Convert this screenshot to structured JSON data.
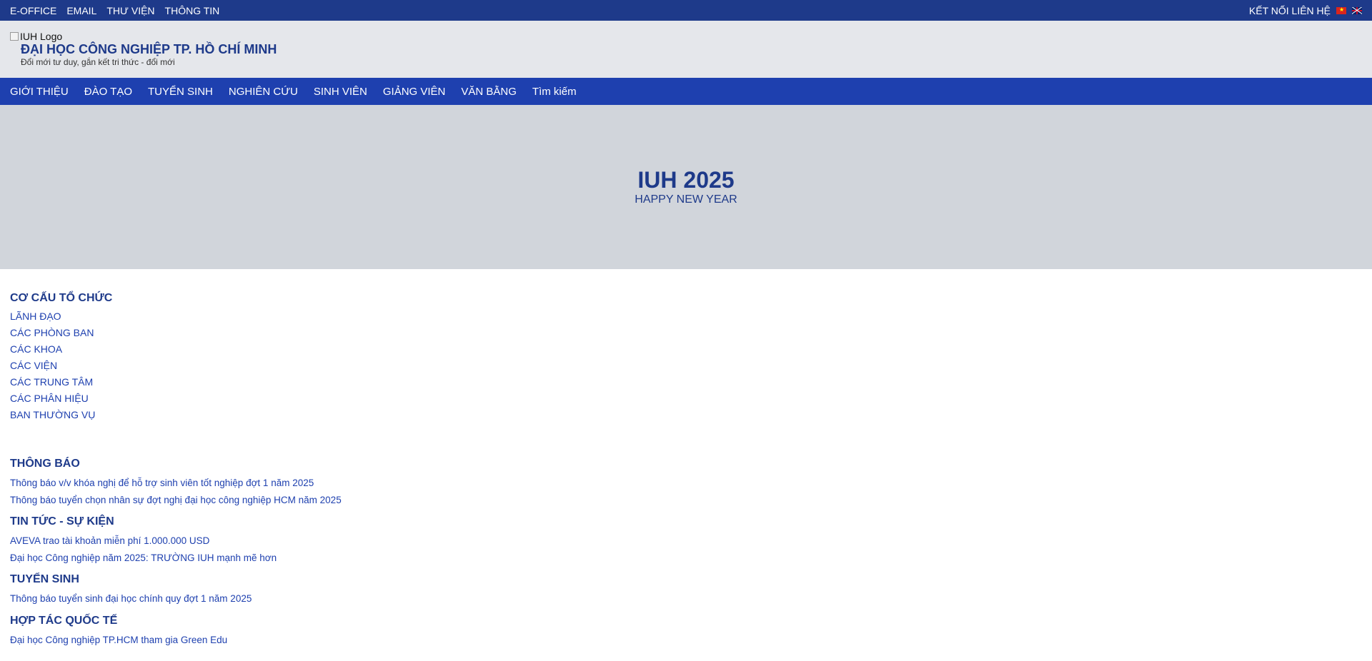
{
  "topbar": {
    "links": [
      "E-OFFICE",
      "EMAIL",
      "THƯ VIỆN",
      "THÔNG TIN"
    ],
    "contact": "KẾT NỐI LIÊN HỆ"
  },
  "brand": {
    "logo_alt": "IUH Logo",
    "title": "ĐẠI HỌC CÔNG NGHIỆP TP. HỒ CHÍ MINH",
    "slogan": "Đổi mới tư duy, gắn kết tri thức - đổi mới"
  },
  "nav": {
    "items": [
      "GIỚI THIỆU",
      "ĐÀO TẠO",
      "TUYỂN SINH",
      "NGHIÊN CỨU",
      "SINH VIÊN",
      "GIẢNG VIÊN",
      "VĂN BẰNG",
      "Tìm kiếm"
    ]
  },
  "hero": {
    "title": "IUH 2025",
    "subtitle": "HAPPY NEW YEAR"
  },
  "org": {
    "heading": "CƠ CẤU TỔ CHỨC",
    "items": [
      "LÃNH ĐẠO",
      "CÁC PHÒNG BAN",
      "CÁC KHOA",
      "CÁC VIỆN",
      "CÁC TRUNG TÂM",
      "CÁC PHÂN HIỆU",
      "BAN THƯỜNG VỤ"
    ]
  },
  "news": {
    "announcements": {
      "heading": "THÔNG BÁO",
      "items": [
        "Thông báo v/v khóa nghị để hỗ trợ sinh viên tốt nghiệp đợt 1 năm 2025",
        "Thông báo tuyển chọn nhân sự đợt nghị đại học công nghiệp HCM năm 2025"
      ]
    },
    "events": {
      "heading": "TIN TỨC - SỰ KIỆN",
      "items": [
        "AVEVA trao tài khoản miễn phí 1.000.000 USD",
        "Đại học Công nghiệp năm 2025: TRƯỜNG IUH mạnh mẽ hơn"
      ]
    },
    "admissions": {
      "heading": "TUYỂN SINH",
      "items": [
        "Thông báo tuyển sinh đại học chính quy đợt 1 năm 2025"
      ]
    },
    "international": {
      "heading": "HỢP TÁC QUỐC TẾ",
      "items": [
        "Đại học Công nghiệp TP.HCM tham gia Green Edu"
      ]
    }
  },
  "icons": {
    "flag_vn": "vietnam-flag-icon",
    "flag_en": "uk-flag-icon"
  },
  "colors": {
    "topbar": "#1e3a8a",
    "nav": "#1e40af",
    "brand_bg": "#e5e7eb",
    "hero_bg": "#d1d5db"
  }
}
